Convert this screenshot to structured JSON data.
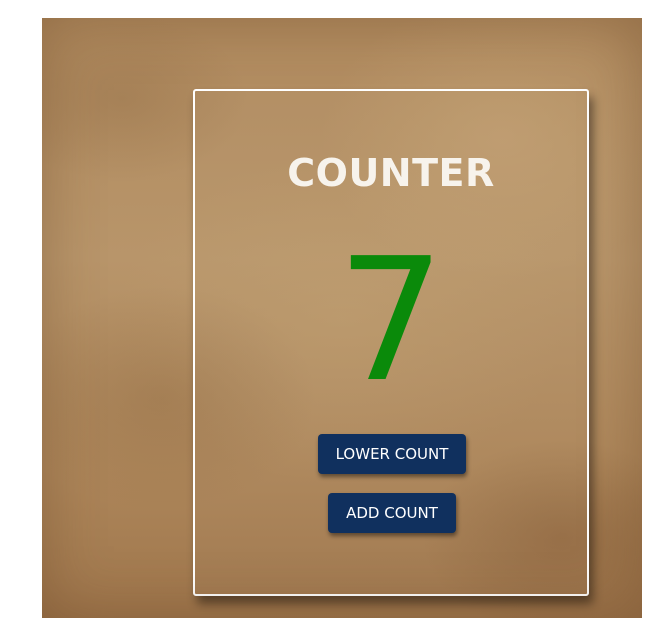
{
  "counter": {
    "title": "COUNTER",
    "value": "7",
    "value_color": "#0a8a0a"
  },
  "buttons": {
    "lower_label": "LOWER COUNT",
    "add_label": "ADD COUNT",
    "button_color": "#10305e"
  }
}
